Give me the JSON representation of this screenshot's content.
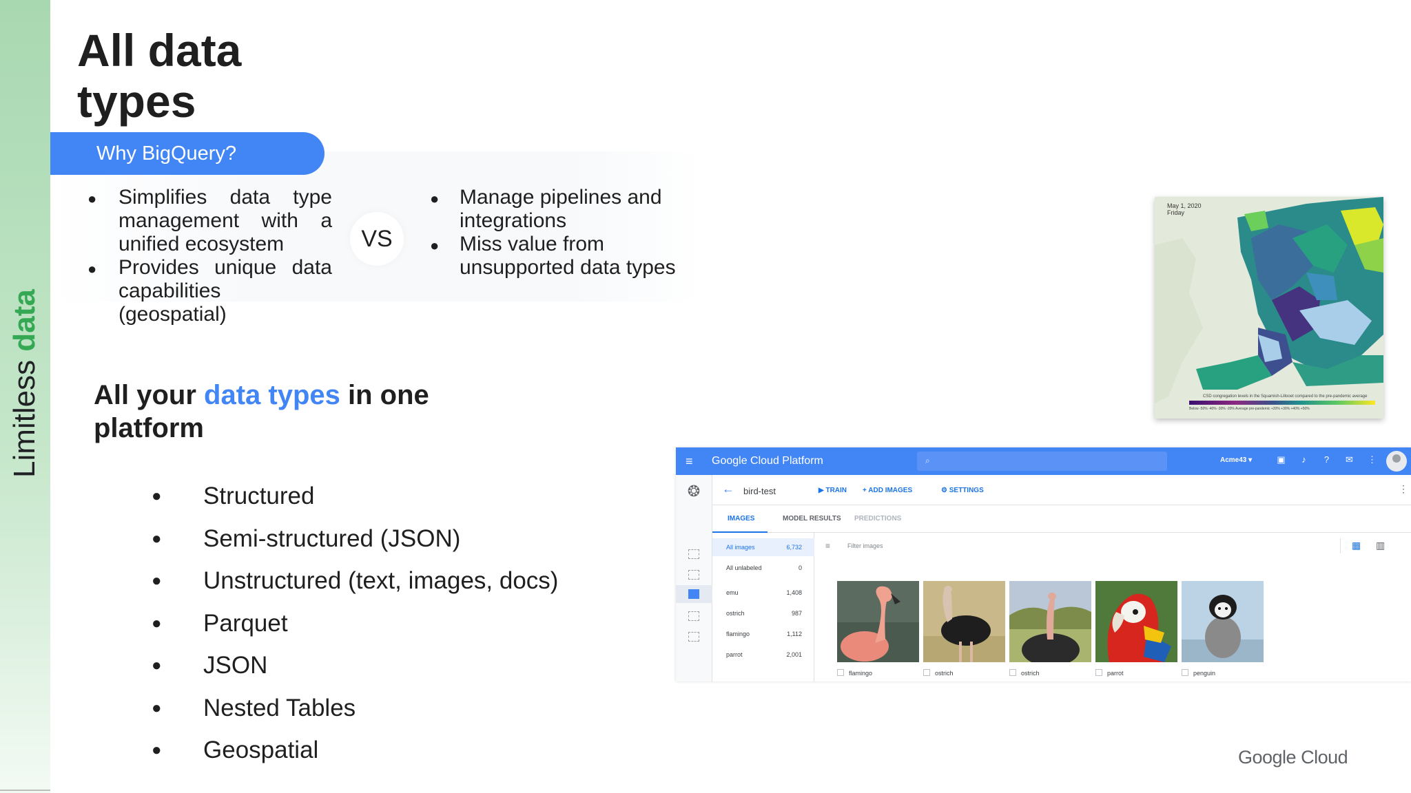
{
  "slide": {
    "side_label_prefix": "Limitless ",
    "side_label_accent": "data",
    "title": "All data types",
    "why_label": "Why BigQuery?",
    "left_points": [
      "Simplifies data type management with a unified ecosystem",
      "Provides unique data capabilities (geospatial)"
    ],
    "vs_label": "VS",
    "right_points": [
      "Manage pipelines and integrations",
      "Miss value from unsupported data types"
    ],
    "subheading_pre": "All your ",
    "subheading_accent": "data types",
    "subheading_post": " in one platform",
    "types": [
      "Structured",
      "Semi-structured (JSON)",
      "Unstructured (text, images, docs)",
      "Parquet",
      "JSON",
      "Nested Tables",
      "Geospatial"
    ],
    "footer_logo": "Google Cloud",
    "colors": {
      "blue": "#4285f4",
      "green": "#34a853"
    }
  },
  "map": {
    "date_line1": "May 1, 2020",
    "date_line2": "Friday",
    "caption": "CSD congregation levels in the Squamish-Lillooet compared to the pre-pandemic average",
    "legend_labels": "Below   -50%   -40%   -30%   -20%   Average pre-pandemic   +20%   +30%   +40%   +50%"
  },
  "console": {
    "brand_google": "Google",
    "brand_rest": " Cloud Platform",
    "project": "Acme43 ▾",
    "dataset": "bird-test",
    "actions": {
      "train": "TRAIN",
      "add_images": "ADD IMAGES",
      "settings": "SETTINGS"
    },
    "tabs": {
      "images": "IMAGES",
      "model_results": "MODEL RESULTS",
      "predictions": "PREDICTIONS"
    },
    "filter_placeholder": "Filter images",
    "labels": [
      {
        "name": "All images",
        "count": "6,732"
      },
      {
        "name": "All unlabeled",
        "count": "0"
      },
      {
        "name": "emu",
        "count": "1,408"
      },
      {
        "name": "ostrich",
        "count": "987"
      },
      {
        "name": "flamingo",
        "count": "1,112"
      },
      {
        "name": "parrot",
        "count": "2,001"
      }
    ],
    "images": [
      "flamingo",
      "ostrich",
      "ostrich",
      "parrot",
      "penguin"
    ]
  }
}
